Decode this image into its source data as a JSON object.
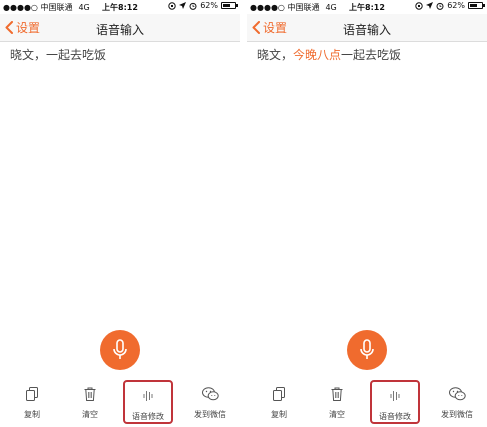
{
  "colors": {
    "accent": "#f06b2e",
    "highlight_box": "#c0343a"
  },
  "screens": [
    {
      "status": {
        "carrier": "●●●●○ 中国联通",
        "network": "4G",
        "time": "上午8:12",
        "battery": "62%",
        "battery_level": 0.62
      },
      "nav": {
        "back_label": "设置",
        "title": "语音输入"
      },
      "text": {
        "part1": "晓文，",
        "highlight": "",
        "part2": "一起去吃饭"
      },
      "mic_icon": "microphone-icon",
      "toolbar": [
        {
          "label": "复制",
          "icon": "copy-icon"
        },
        {
          "label": "清空",
          "icon": "trash-icon"
        },
        {
          "label": "语音修改",
          "icon": "voice-wave-icon"
        },
        {
          "label": "发到微信",
          "icon": "wechat-icon"
        }
      ]
    },
    {
      "status": {
        "carrier": "●●●●○ 中国联通",
        "network": "4G",
        "time": "上午8:12",
        "battery": "62%",
        "battery_level": 0.62
      },
      "nav": {
        "back_label": "设置",
        "title": "语音输入"
      },
      "text": {
        "part1": "晓文，",
        "highlight": "今晚八点",
        "part2": "一起去吃饭"
      },
      "mic_icon": "microphone-icon",
      "toolbar": [
        {
          "label": "复制",
          "icon": "copy-icon"
        },
        {
          "label": "清空",
          "icon": "trash-icon"
        },
        {
          "label": "语音修改",
          "icon": "voice-wave-icon"
        },
        {
          "label": "发到微信",
          "icon": "wechat-icon"
        }
      ]
    }
  ]
}
